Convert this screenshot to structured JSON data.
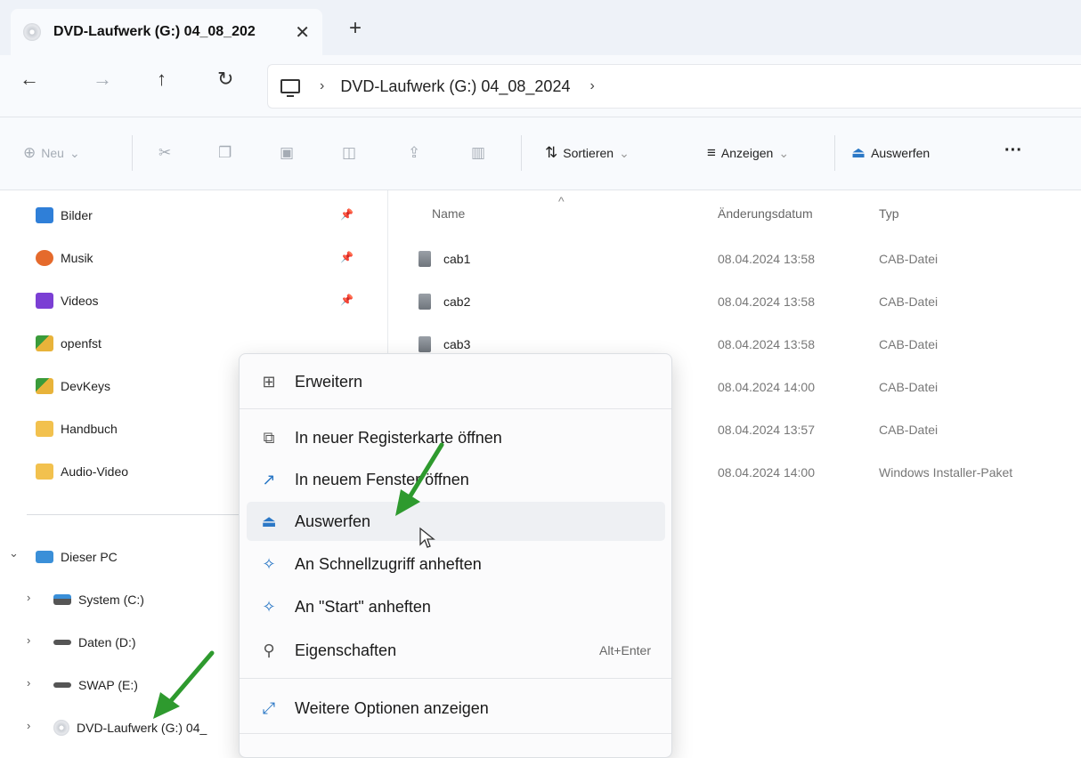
{
  "tab": {
    "title": "DVD-Laufwerk (G:) 04_08_202",
    "close": "✕",
    "new": "+"
  },
  "nav": {
    "back": "←",
    "forward": "→",
    "up": "↑",
    "refresh": "↻"
  },
  "address": {
    "chevron": "›",
    "location": "DVD-Laufwerk (G:) 04_08_2024"
  },
  "toolbar": {
    "new_label": "Neu",
    "sort_label": "Sortieren",
    "view_label": "Anzeigen",
    "eject_label": "Auswerfen",
    "more": "···",
    "dropdown": "⌄"
  },
  "sidebar": {
    "quick": [
      {
        "label": "Bilder",
        "color": "#2f7fd8"
      },
      {
        "label": "Musik",
        "color": "#e56a2c"
      },
      {
        "label": "Videos",
        "color": "#7b3fd4"
      },
      {
        "label": "openfst",
        "color": "#e8b33a"
      },
      {
        "label": "DevKeys",
        "color": "#e8b33a"
      },
      {
        "label": "Handbuch",
        "color": "#f2c14e"
      },
      {
        "label": "Audio-Video",
        "color": "#f2c14e"
      }
    ],
    "pc_label": "Dieser PC",
    "drives": [
      {
        "label": "System (C:)"
      },
      {
        "label": "Daten (D:)"
      },
      {
        "label": "SWAP (E:)"
      },
      {
        "label": "DVD-Laufwerk (G:) 04_"
      }
    ]
  },
  "columns": {
    "name": "Name",
    "date": "Änderungsdatum",
    "type": "Typ"
  },
  "files": [
    {
      "name": "cab1",
      "date": "08.04.2024 13:58",
      "type": "CAB-Datei"
    },
    {
      "name": "cab2",
      "date": "08.04.2024 13:58",
      "type": "CAB-Datei"
    },
    {
      "name": "cab3",
      "date": "08.04.2024 13:58",
      "type": "CAB-Datei"
    },
    {
      "name": "",
      "date": "08.04.2024 14:00",
      "type": "CAB-Datei"
    },
    {
      "name": "",
      "date": "08.04.2024 13:57",
      "type": "CAB-Datei"
    },
    {
      "name": "",
      "date": "08.04.2024 14:00",
      "type": "Windows Installer-Paket"
    }
  ],
  "context_menu": {
    "expand": "Erweitern",
    "open_new_tab": "In neuer Registerkarte öffnen",
    "open_new_window": "In neuem Fenster öffnen",
    "eject": "Auswerfen",
    "pin_quick": "An Schnellzugriff anheften",
    "pin_start": "An \"Start\" anheften",
    "properties": "Eigenschaften",
    "properties_shortcut": "Alt+Enter",
    "more_options": "Weitere Optionen anzeigen"
  },
  "colors": {
    "accent": "#2b78c6",
    "arrow": "#2e9a2e"
  }
}
